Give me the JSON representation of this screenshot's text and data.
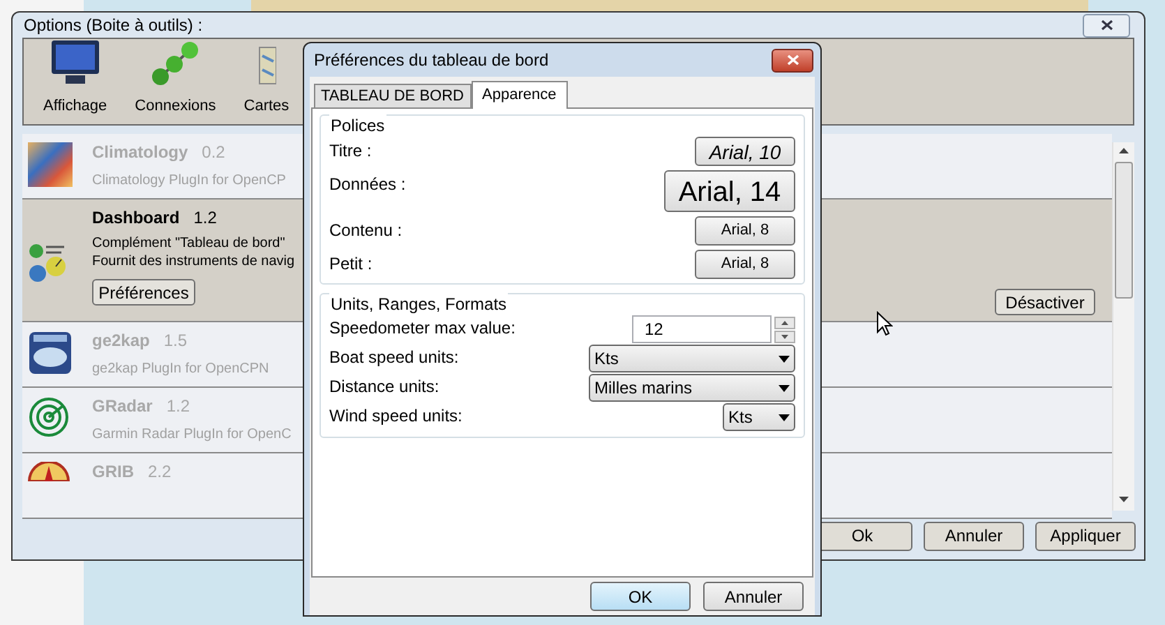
{
  "options_window": {
    "title": "Options (Boite à outils) :",
    "toolbar": [
      {
        "label": "Affichage"
      },
      {
        "label": "Connexions"
      },
      {
        "label": "Cartes"
      }
    ],
    "plugins": [
      {
        "name": "Climatology",
        "version": "0.2",
        "description": [
          "Climatology PlugIn for OpenCP"
        ],
        "enabled": false,
        "selected": false
      },
      {
        "name": "Dashboard",
        "version": "1.2",
        "description": [
          "Complément \"Tableau de bord\"",
          "Fournit des instruments de navig"
        ],
        "enabled": true,
        "selected": true,
        "preferences_button": "Préférences",
        "toggle_button": "Désactiver"
      },
      {
        "name": "ge2kap",
        "version": "1.5",
        "description": [
          "ge2kap PlugIn for OpenCPN"
        ],
        "enabled": false,
        "selected": false
      },
      {
        "name": "GRadar",
        "version": "1.2",
        "description": [
          "Garmin Radar PlugIn for OpenC"
        ],
        "enabled": false,
        "selected": false
      },
      {
        "name": "GRIB",
        "version": "2.2",
        "enabled": false,
        "selected": false
      }
    ],
    "buttons": [
      "Ok",
      "Annuler",
      "Appliquer"
    ]
  },
  "preferences_dialog": {
    "title": "Préférences du tableau de bord",
    "tabs": [
      {
        "label": "TABLEAU DE BORD",
        "selected": false
      },
      {
        "label": "Apparence",
        "selected": true
      }
    ],
    "fonts_group": {
      "title": "Polices",
      "rows": [
        {
          "label": "Titre :",
          "font": "Arial, 10",
          "kind": "title"
        },
        {
          "label": "Données :",
          "font": "Arial, 14",
          "kind": "data"
        },
        {
          "label": "Contenu :",
          "font": "Arial, 8",
          "kind": "content"
        },
        {
          "label": "Petit :",
          "font": "Arial, 8",
          "kind": "small"
        }
      ]
    },
    "units_group": {
      "title": "Units, Ranges, Formats",
      "rows": [
        {
          "label": "Speedometer max value:",
          "value": "12",
          "kind": "spin"
        },
        {
          "label": "Boat speed units:",
          "value": "Kts",
          "kind": "select"
        },
        {
          "label": "Distance units:",
          "value": "Milles marins",
          "kind": "select"
        },
        {
          "label": "Wind speed units:",
          "value": "Kts",
          "kind": "compact_select"
        }
      ]
    },
    "buttons": [
      {
        "label": "OK",
        "focused": true
      },
      {
        "label": "Annuler",
        "focused": false
      }
    ]
  }
}
